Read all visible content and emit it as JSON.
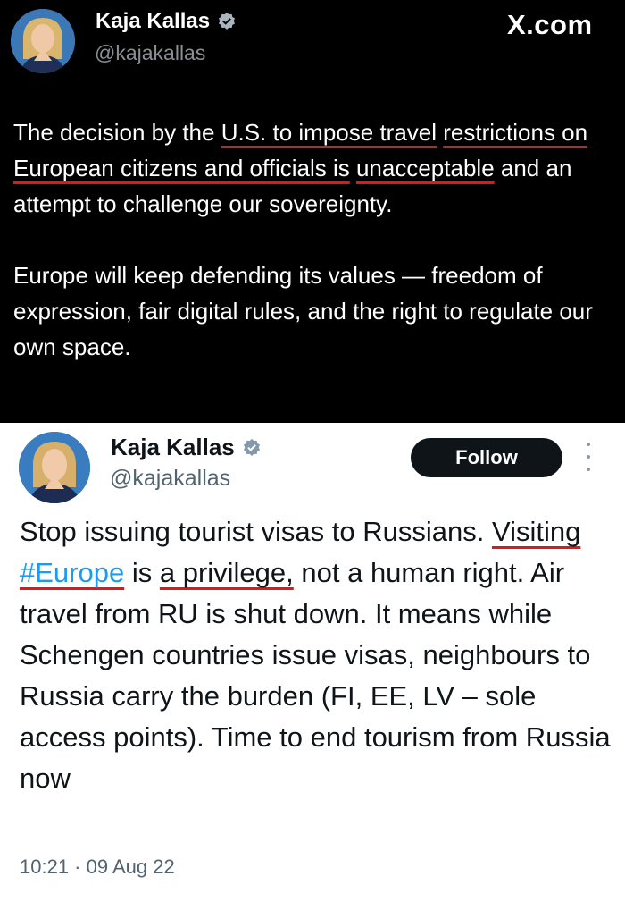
{
  "top_tweet": {
    "author_name": "Kaja Kallas",
    "author_handle": "@kajakallas",
    "site": "X.com",
    "p1_a": "The decision by the ",
    "p1_ul1": "U.S. to impose travel",
    "p1_ul2": "restrictions on European citizens and officials is",
    "p1_ul3": "unacceptable",
    "p1_b": " and an attempt to challenge our sovereignty.",
    "p2": "Europe will keep defending its values — freedom of expression, fair digital rules, and the right to regulate our own space.",
    "badge_icon": "verified-badge-icon"
  },
  "bottom_tweet": {
    "author_name": "Kaja Kallas",
    "author_handle": "@kajakallas",
    "follow_label": "Follow",
    "t1": "Stop issuing tourist visas to Russians. ",
    "t_ul1": "Visiting",
    "t_hashtag": "#Europe",
    "t2": " is ",
    "t_ul2": "a privilege,",
    "t3": " not a human right. Air travel from RU is shut down. It means while Schengen countries issue visas, neighbours to Russia carry the burden (FI, EE, LV – sole access points). Time to end tourism from Russia now",
    "timestamp": "10:21 · 09 Aug 22",
    "badge_icon": "verified-badge-icon",
    "more_icon": "more-options-icon"
  },
  "colors": {
    "underline": "#e3161b",
    "hashtag": "#1d9bf0",
    "dark_bg": "#000000"
  }
}
